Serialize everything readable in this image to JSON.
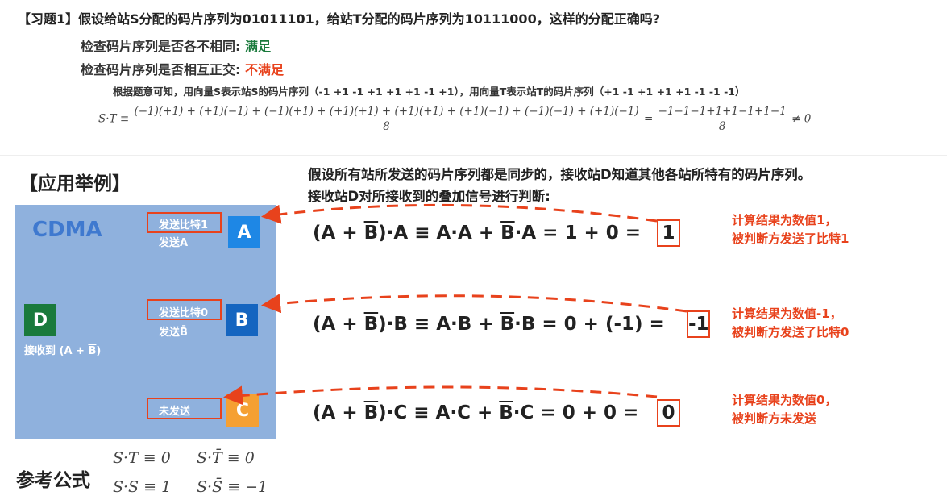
{
  "question": {
    "title": "【习题1】假设给站S分配的码片序列为01011101，给站T分配的码片序列为10111000，这样的分配正确吗?",
    "check1_label": "检查码片序列是否各不相同:",
    "check1_result": "满足",
    "check2_label": "检查码片序列是否相互正交:",
    "check2_result": "不满足",
    "note": "根据题意可知，用向量S表示站S的码片序列（-1 +1 -1 +1 +1 +1 -1 +1），用向量T表示站T的码片序列（+1 -1 +1 +1 +1 -1 -1 -1）",
    "formula_lhs": "S·T ≡",
    "formula_num": "(−1)(+1) + (+1)(−1) + (−1)(+1) + (+1)(+1) + (+1)(+1) + (+1)(−1) + (−1)(−1) + (+1)(−1)",
    "formula_den": "8",
    "formula_eq": "=",
    "formula_num2": "−1−1−1+1+1−1+1−1",
    "formula_den2": "8",
    "formula_ne": "≠ 0"
  },
  "example": {
    "section_title": "【应用举例】",
    "desc_line1": "假设所有站所发送的码片序列都是同步的，接收站D知道其他各站所特有的码片序列。",
    "desc_line2": "接收站D对所接收到的叠加信号进行判断:",
    "panel_title": "CDMA",
    "station_d": "D",
    "receive_prefix": "接收到 (A + ",
    "receive_b": "B",
    "receive_suffix": ")",
    "stations": [
      {
        "name": "A",
        "box_label": "发送比特1",
        "sub_label": "发送A",
        "color": "#1e87e5"
      },
      {
        "name": "B",
        "box_label": "发送比特0",
        "sub_label": "发送B̄",
        "color": "#1565c0"
      },
      {
        "name": "C",
        "box_label": "未发送",
        "sub_label": "",
        "color": "#f5a033"
      }
    ],
    "equations": [
      {
        "pre": "(A + ",
        "bar": "B",
        "mid": ")·A ≡ A·A + ",
        "bar2": "B",
        "post": "·A = 1 + 0 =",
        "result": "1"
      },
      {
        "pre": "(A + ",
        "bar": "B",
        "mid": ")·B ≡ A·B + ",
        "bar2": "B",
        "post": "·B = 0 + (-1) =",
        "result": "-1"
      },
      {
        "pre": "(A + ",
        "bar": "B",
        "mid": ")·C ≡ A·C + ",
        "bar2": "B",
        "post": "·C = 0 + 0 =",
        "result": "0"
      }
    ],
    "results": [
      {
        "line1": "计算结果为数值1，",
        "line2": "被判断方发送了比特1"
      },
      {
        "line1": "计算结果为数值-1，",
        "line2": "被判断方发送了比特0"
      },
      {
        "line1": "计算结果为数值0，",
        "line2": "被判断方未发送"
      }
    ]
  },
  "reference": {
    "title": "参考公式",
    "f1": "S·T ≡ 0",
    "f2": "S·T̄ ≡ 0",
    "f3": "S·S ≡ 1",
    "f4": "S·S̄ ≡ −1"
  },
  "colors": {
    "accent_red": "#e8421c",
    "ok_green": "#1a7a3c",
    "panel_blue": "#8fb1dd",
    "station_d": "#1a7a3c"
  }
}
